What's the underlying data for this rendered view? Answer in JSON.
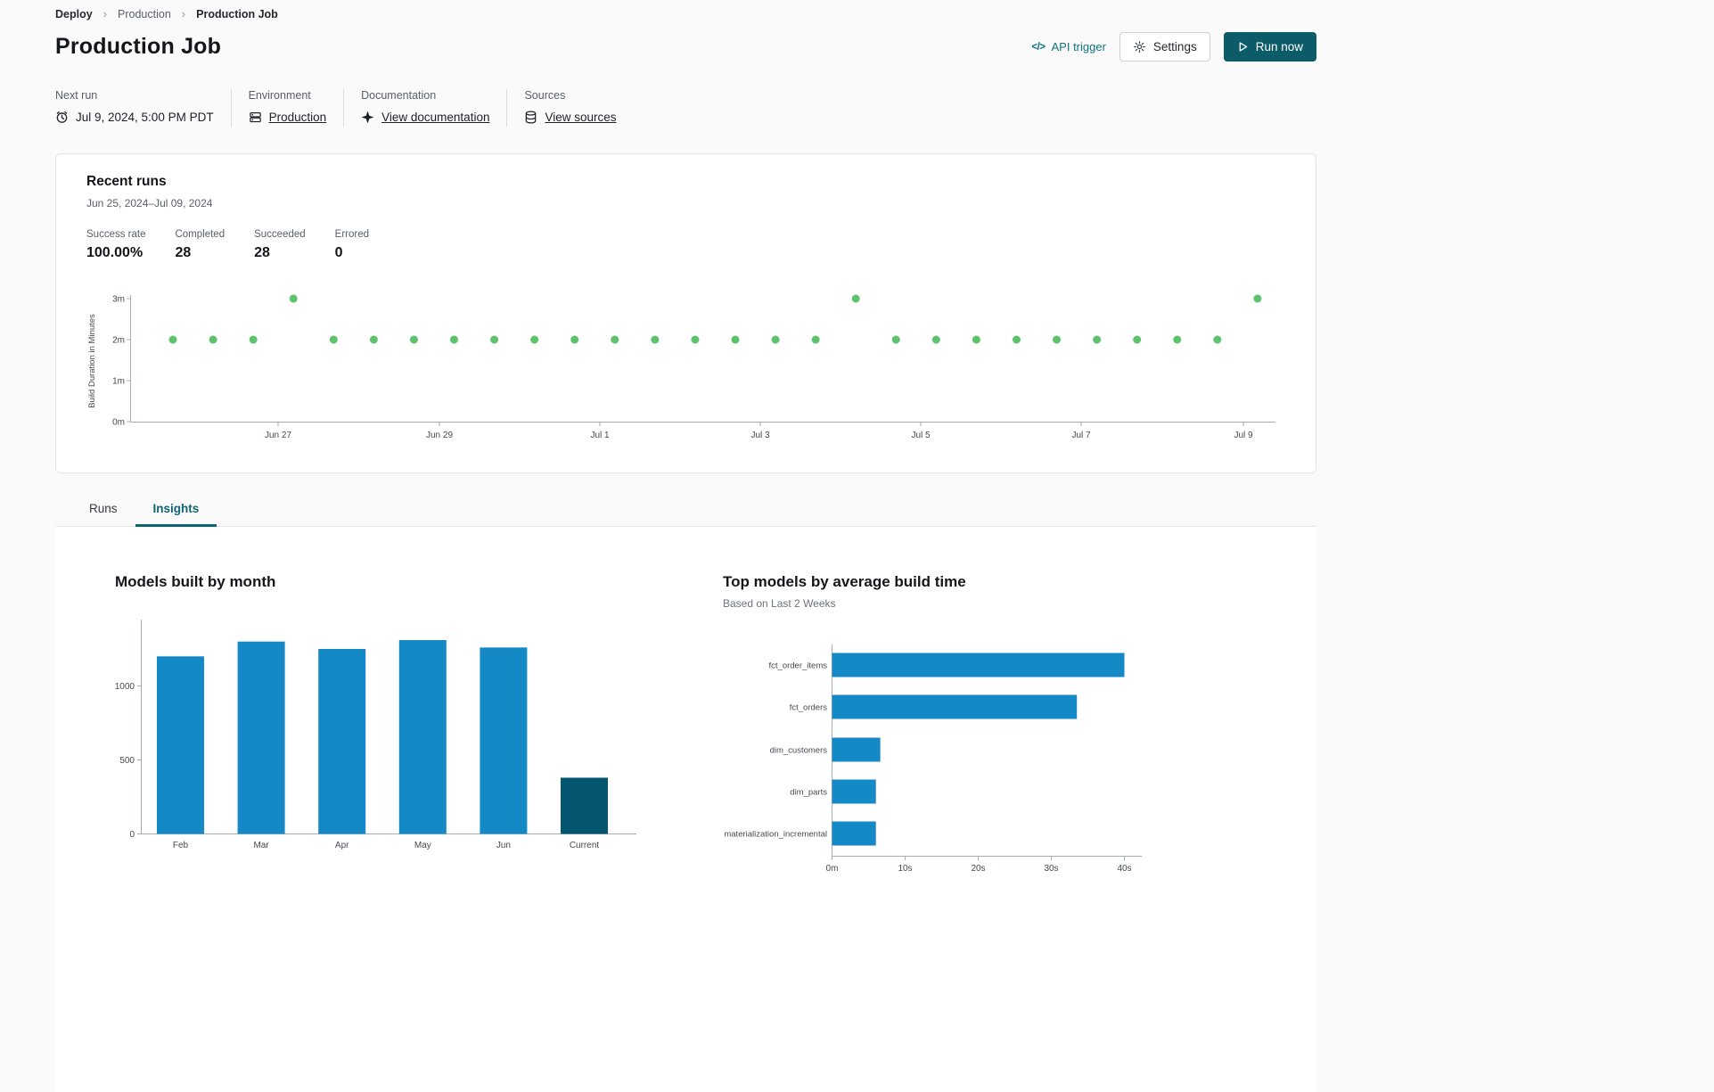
{
  "colors": {
    "accent_teal": "#0b5c68",
    "link_teal": "#0d7280",
    "page_bg": "#fafafa",
    "card_border": "#e3e6e8",
    "bar_blue": "#1489c5",
    "bar_dark_teal": "#03566e",
    "dot_green": "#5cc36a",
    "text_primary": "#1c2126",
    "text_secondary": "#57606a"
  },
  "breadcrumb": {
    "separator": "›",
    "items": [
      "Deploy",
      "Production",
      "Production Job"
    ]
  },
  "header": {
    "title": "Production Job",
    "api_trigger": {
      "icon": "</>",
      "label": "API trigger"
    },
    "settings_label": "Settings",
    "run_now_label": "Run now"
  },
  "meta": {
    "next_run": {
      "label": "Next run",
      "value": "Jul 9, 2024, 5:00 PM PDT"
    },
    "environment": {
      "label": "Environment",
      "value": "Production"
    },
    "documentation": {
      "label": "Documentation",
      "value": "View documentation"
    },
    "sources": {
      "label": "Sources",
      "value": "View sources"
    }
  },
  "recent_runs": {
    "title": "Recent runs",
    "date_range": "Jun 25, 2024–Jul 09, 2024",
    "stats": [
      {
        "label": "Success rate",
        "value": "100.00%"
      },
      {
        "label": "Completed",
        "value": "28"
      },
      {
        "label": "Succeeded",
        "value": "28"
      },
      {
        "label": "Errored",
        "value": "0"
      }
    ]
  },
  "tabs": [
    {
      "label": "Runs",
      "active": false
    },
    {
      "label": "Insights",
      "active": true
    }
  ],
  "chart_data": [
    {
      "id": "run-durations",
      "type": "scatter",
      "ylabel": "Build Duration in Minutes",
      "yticks": [
        {
          "label": "0m",
          "value": 0
        },
        {
          "label": "1m",
          "value": 1
        },
        {
          "label": "2m",
          "value": 2
        },
        {
          "label": "3m",
          "value": 3
        }
      ],
      "xticks": [
        "Jun 27",
        "Jun 29",
        "Jul 1",
        "Jul 3",
        "Jul 5",
        "Jul 7",
        "Jul 9"
      ],
      "ylim": [
        0,
        3
      ],
      "grid": false,
      "points_minutes": [
        2,
        2,
        2,
        3,
        2,
        2,
        2,
        2,
        2,
        2,
        2,
        2,
        2,
        2,
        2,
        2,
        2,
        3,
        2,
        2,
        2,
        2,
        2,
        2,
        2,
        2,
        2,
        3
      ],
      "dot_color": "#5cc36a"
    },
    {
      "id": "models-built-by-month",
      "type": "bar",
      "title": "Models built by month",
      "categories": [
        "Feb",
        "Mar",
        "Apr",
        "May",
        "Jun",
        "Current"
      ],
      "values": [
        1200,
        1300,
        1250,
        1310,
        1260,
        380
      ],
      "yticks": [
        0,
        500,
        1000
      ],
      "ylim": [
        0,
        1450
      ],
      "bar_color": "#1489c5",
      "highlight_index": 5,
      "highlight_color": "#03566e"
    },
    {
      "id": "top-models-by-avg-build-time",
      "type": "hbar",
      "title": "Top models by average build time",
      "subtitle": "Based on Last 2 Weeks",
      "categories": [
        "fct_order_items",
        "fct_orders",
        "dim_customers",
        "dim_parts",
        "materialization_incremental"
      ],
      "values_seconds": [
        40,
        33.5,
        6.6,
        6,
        6
      ],
      "xticks": [
        {
          "label": "0m",
          "value": 0
        },
        {
          "label": "10s",
          "value": 10
        },
        {
          "label": "20s",
          "value": 20
        },
        {
          "label": "30s",
          "value": 30
        },
        {
          "label": "40s",
          "value": 40
        }
      ],
      "xlim": [
        0,
        44
      ],
      "bar_color": "#1489c5"
    }
  ]
}
